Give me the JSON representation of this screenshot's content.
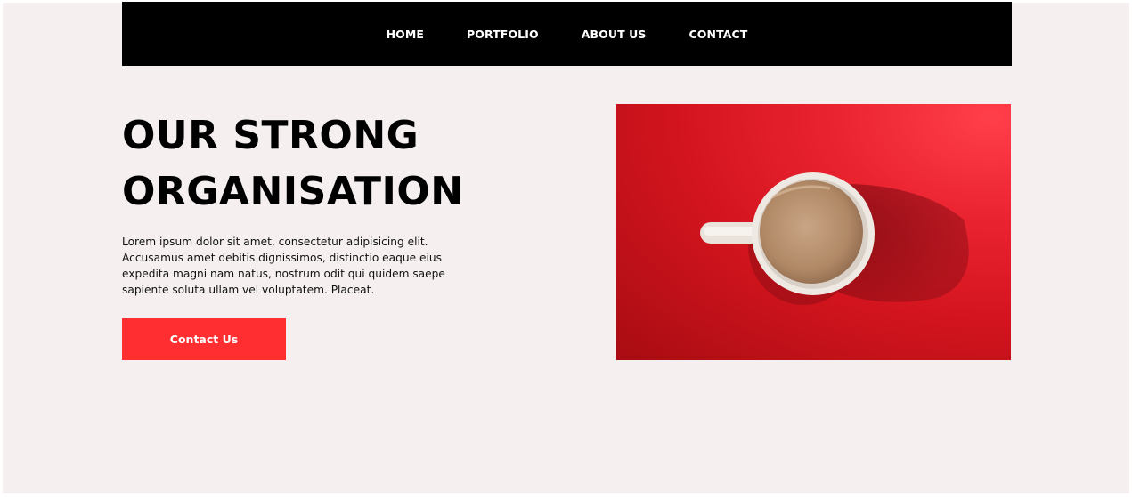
{
  "nav": {
    "items": [
      {
        "label": "HOME"
      },
      {
        "label": "PORTFOLIO"
      },
      {
        "label": "ABOUT US"
      },
      {
        "label": "CONTACT"
      }
    ]
  },
  "hero": {
    "title_line1": "OUR STRONG",
    "title_line2": "ORGANISATION",
    "description": "Lorem ipsum dolor sit amet, consectetur adipisicing elit. Accusamus amet debitis dignissimos, distinctio eaque eius expedita magni nam natus, nostrum odit qui quidem saepe sapiente soluta ullam vel voluptatem. Placeat.",
    "button_label": "Contact Us"
  },
  "colors": {
    "nav_background": "#000000",
    "page_background": "#f5f0ef",
    "accent": "#ff2e30",
    "image_background": "#d2141e"
  }
}
